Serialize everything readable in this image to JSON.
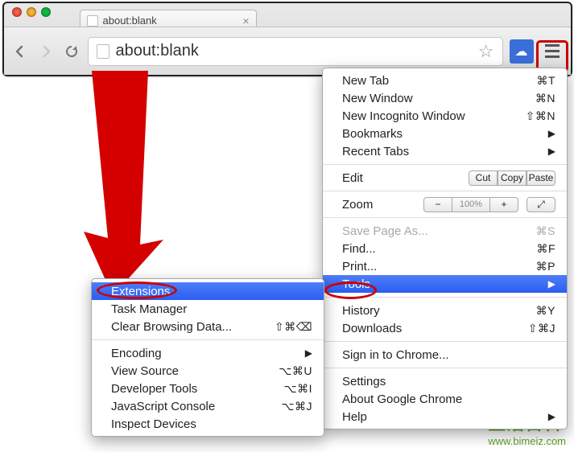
{
  "tab": {
    "title": "about:blank"
  },
  "omnibox": {
    "url": "about:blank"
  },
  "menu": {
    "new_tab": {
      "label": "New Tab",
      "shortcut": "⌘T"
    },
    "new_window": {
      "label": "New Window",
      "shortcut": "⌘N"
    },
    "new_incognito": {
      "label": "New Incognito Window",
      "shortcut": "⇧⌘N"
    },
    "bookmarks": {
      "label": "Bookmarks"
    },
    "recent_tabs": {
      "label": "Recent Tabs"
    },
    "edit": {
      "label": "Edit",
      "cut": "Cut",
      "copy": "Copy",
      "paste": "Paste"
    },
    "zoom": {
      "label": "Zoom",
      "minus": "−",
      "value": "100%",
      "plus": "+",
      "fullscreen": "⤢"
    },
    "save_as": {
      "label": "Save Page As...",
      "shortcut": "⌘S"
    },
    "find": {
      "label": "Find...",
      "shortcut": "⌘F"
    },
    "print": {
      "label": "Print...",
      "shortcut": "⌘P"
    },
    "tools": {
      "label": "Tools"
    },
    "history": {
      "label": "History",
      "shortcut": "⌘Y"
    },
    "downloads": {
      "label": "Downloads",
      "shortcut": "⇧⌘J"
    },
    "signin": {
      "label": "Sign in to Chrome..."
    },
    "settings": {
      "label": "Settings"
    },
    "about": {
      "label": "About Google Chrome"
    },
    "help": {
      "label": "Help"
    }
  },
  "tools_menu": {
    "extensions": {
      "label": "Extensions"
    },
    "task_manager": {
      "label": "Task Manager"
    },
    "clear_browsing": {
      "label": "Clear Browsing Data...",
      "shortcut": "⇧⌘⌫"
    },
    "encoding": {
      "label": "Encoding"
    },
    "view_source": {
      "label": "View Source",
      "shortcut": "⌥⌘U"
    },
    "dev_tools": {
      "label": "Developer Tools",
      "shortcut": "⌥⌘I"
    },
    "js_console": {
      "label": "JavaScript Console",
      "shortcut": "⌥⌘J"
    },
    "inspect_devices": {
      "label": "Inspect Devices"
    }
  },
  "watermark": {
    "top": "生活百科",
    "url": "www.bimeiz.com"
  }
}
